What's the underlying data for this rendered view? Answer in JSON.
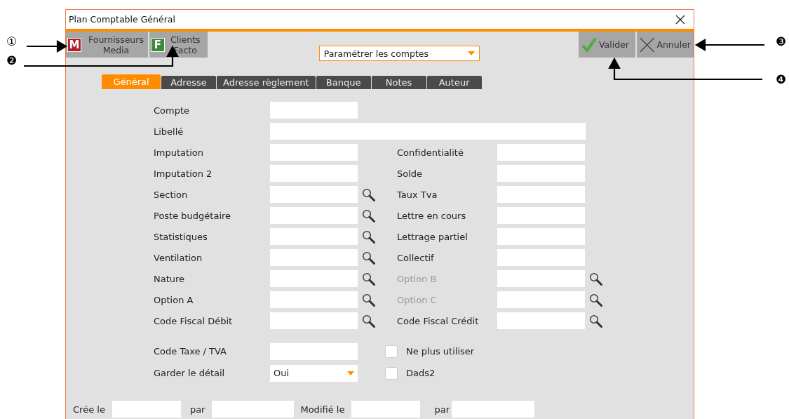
{
  "window": {
    "title": "Plan Comptable Général"
  },
  "toolbar": {
    "left_buttons": [
      {
        "badge": "M",
        "color": "#b01e23",
        "label_lines": [
          "Fournisseurs",
          "Media"
        ]
      },
      {
        "badge": "F",
        "color": "#3f8a3a",
        "label_lines": [
          "Clients",
          "Facto"
        ]
      }
    ],
    "dropdown": {
      "value": "Paramétrer les comptes"
    },
    "right_buttons": [
      {
        "kind": "validate",
        "label": "Valider"
      },
      {
        "kind": "cancel",
        "label": "Annuler"
      }
    ]
  },
  "tabs": [
    {
      "label": "Général",
      "selected": true
    },
    {
      "label": "Adresse",
      "selected": false
    },
    {
      "label": "Adresse règlement",
      "selected": false
    },
    {
      "label": "Banque",
      "selected": false
    },
    {
      "label": "Notes",
      "selected": false
    },
    {
      "label": "Auteur",
      "selected": false
    }
  ],
  "form": {
    "sections": [
      {
        "rows": [
          [
            {
              "kind": "text",
              "label": "Compte",
              "lookup": false,
              "disabled": false
            }
          ],
          [
            {
              "kind": "wide_text",
              "label": "Libellé",
              "disabled": false
            }
          ],
          [
            {
              "kind": "text",
              "label": "Imputation",
              "lookup": false,
              "disabled": false
            },
            {
              "kind": "text",
              "label": "Confidentialité",
              "lookup": false,
              "disabled": false
            }
          ],
          [
            {
              "kind": "text",
              "label": "Imputation 2",
              "lookup": false,
              "disabled": false
            },
            {
              "kind": "text",
              "label": "Solde",
              "lookup": false,
              "disabled": false
            }
          ],
          [
            {
              "kind": "text",
              "label": "Section",
              "lookup": true,
              "disabled": false
            },
            {
              "kind": "text",
              "label": "Taux Tva",
              "lookup": false,
              "disabled": false
            }
          ],
          [
            {
              "kind": "text",
              "label": "Poste budgétaire",
              "lookup": true,
              "disabled": false
            },
            {
              "kind": "text",
              "label": "Lettre en cours",
              "lookup": false,
              "disabled": false
            }
          ],
          [
            {
              "kind": "text",
              "label": "Statistiques",
              "lookup": true,
              "disabled": false
            },
            {
              "kind": "text",
              "label": "Lettrage partiel",
              "lookup": false,
              "disabled": false
            }
          ],
          [
            {
              "kind": "text",
              "label": "Ventilation",
              "lookup": true,
              "disabled": false
            },
            {
              "kind": "text",
              "label": "Collectif",
              "lookup": false,
              "disabled": false
            }
          ],
          [
            {
              "kind": "text",
              "label": "Nature",
              "lookup": true,
              "disabled": false
            },
            {
              "kind": "text",
              "label": "Option B",
              "lookup": true,
              "disabled": true
            }
          ],
          [
            {
              "kind": "text",
              "label": "Option A",
              "lookup": true,
              "disabled": false
            },
            {
              "kind": "text",
              "label": "Option C",
              "lookup": true,
              "disabled": true
            }
          ],
          [
            {
              "kind": "text",
              "label": "Code Fiscal Débit",
              "lookup": true,
              "disabled": false
            },
            {
              "kind": "text",
              "label": "Code Fiscal Crédit",
              "lookup": true,
              "disabled": false
            }
          ]
        ]
      },
      {
        "rows": [
          [
            {
              "kind": "text",
              "label": "Code Taxe / TVA",
              "lookup": false,
              "disabled": false
            },
            {
              "kind": "checkbox",
              "label": "Ne plus utiliser",
              "checked": false
            }
          ],
          [
            {
              "kind": "select",
              "label": "Garder le détail",
              "value": "Oui"
            },
            {
              "kind": "checkbox",
              "label": "Dads2",
              "checked": false
            }
          ]
        ]
      }
    ]
  },
  "footer": {
    "fields": [
      {
        "label": "Crée le"
      },
      {
        "label": "par"
      },
      {
        "label": "Modifié le"
      },
      {
        "label": "par"
      }
    ]
  },
  "callouts": [
    {
      "number": "①"
    },
    {
      "number": "❷"
    },
    {
      "number": "❸"
    },
    {
      "number": "❹"
    }
  ]
}
